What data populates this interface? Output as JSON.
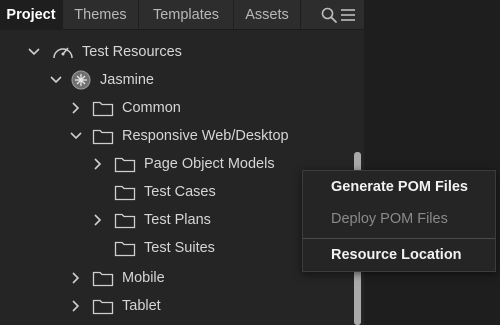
{
  "tabs": [
    {
      "label": "Project",
      "active": true
    },
    {
      "label": "Themes",
      "active": false
    },
    {
      "label": "Templates",
      "active": false
    },
    {
      "label": "Assets",
      "active": false
    }
  ],
  "tab_icons": [
    "search-icon",
    "menu-icon"
  ],
  "tree": [
    {
      "label": "Test Resources",
      "icon": "gauge-icon",
      "expanded": true
    },
    {
      "label": "Jasmine",
      "icon": "jasmine-logo-icon",
      "expanded": true
    },
    {
      "label": "Common",
      "icon": "folder-icon",
      "expanded": false
    },
    {
      "label": "Responsive Web/Desktop",
      "icon": "folder-icon",
      "expanded": true
    },
    {
      "label": "Page Object Models",
      "icon": "folder-icon",
      "expanded": false
    },
    {
      "label": "Test Cases",
      "icon": "folder-icon",
      "expanded": null
    },
    {
      "label": "Test Plans",
      "icon": "folder-icon",
      "expanded": false
    },
    {
      "label": "Test Suites",
      "icon": "folder-icon",
      "expanded": null
    },
    {
      "label": "Mobile",
      "icon": "folder-icon",
      "expanded": false
    },
    {
      "label": "Tablet",
      "icon": "folder-icon",
      "expanded": false
    }
  ],
  "context_menu": {
    "items": [
      {
        "label": "Generate POM Files",
        "enabled": true
      },
      {
        "label": "Deploy POM Files",
        "enabled": false
      },
      {
        "label": "Resource Location",
        "enabled": true
      }
    ]
  },
  "colors": {
    "background": "#1e1e1e",
    "panel": "#252526",
    "text": "#d6d6d6",
    "disabled_text": "#8a8a8a"
  }
}
